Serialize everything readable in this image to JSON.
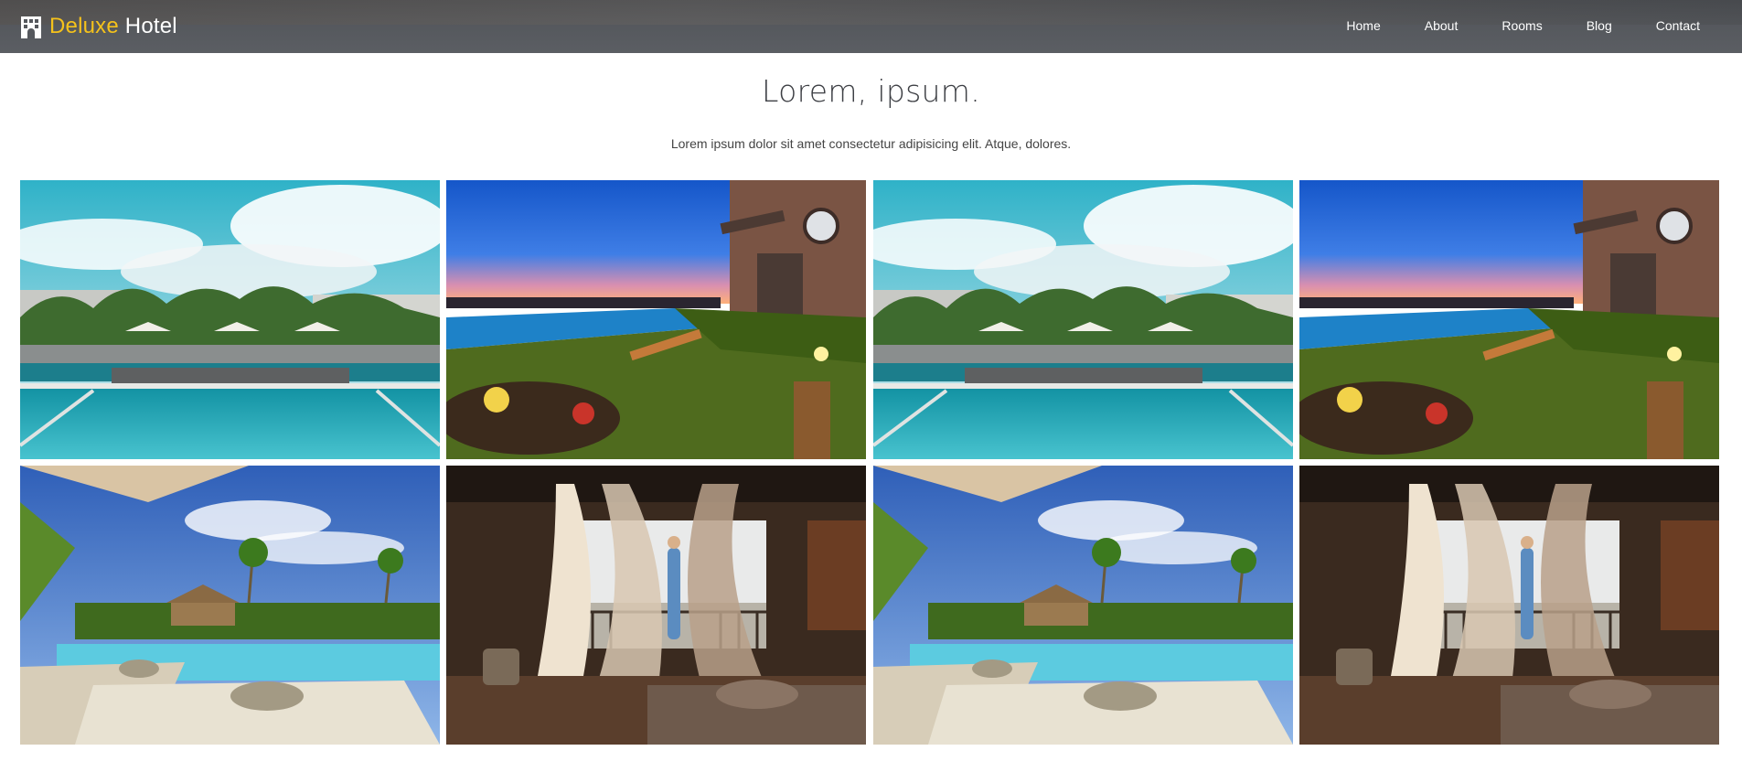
{
  "navbar": {
    "brand_icon": "hotel-building-icon",
    "brand_primary": "Deluxe",
    "brand_secondary": "Hotel",
    "links": [
      "Home",
      "About",
      "Rooms",
      "Blog",
      "Contact"
    ]
  },
  "intro": {
    "title": "Lorem, ipsum.",
    "text": "Lorem ipsum dolor sit amet consectetur adipisicing elit. Atque, dolores."
  },
  "gallery": {
    "images": [
      "pool-with-umbrellas-daytime",
      "pool-terrace-at-sunset",
      "pool-with-umbrellas-daytime",
      "pool-terrace-at-sunset",
      "tropical-resort-pool-loungers",
      "canopy-bedroom-balcony-view",
      "tropical-resort-pool-loungers",
      "canopy-bedroom-balcony-view"
    ]
  },
  "colors": {
    "brand_accent": "#f5c21b",
    "navbar_bg": "#575a5f",
    "nav_text": "#ffffff",
    "title_text": "#3d3f44"
  }
}
